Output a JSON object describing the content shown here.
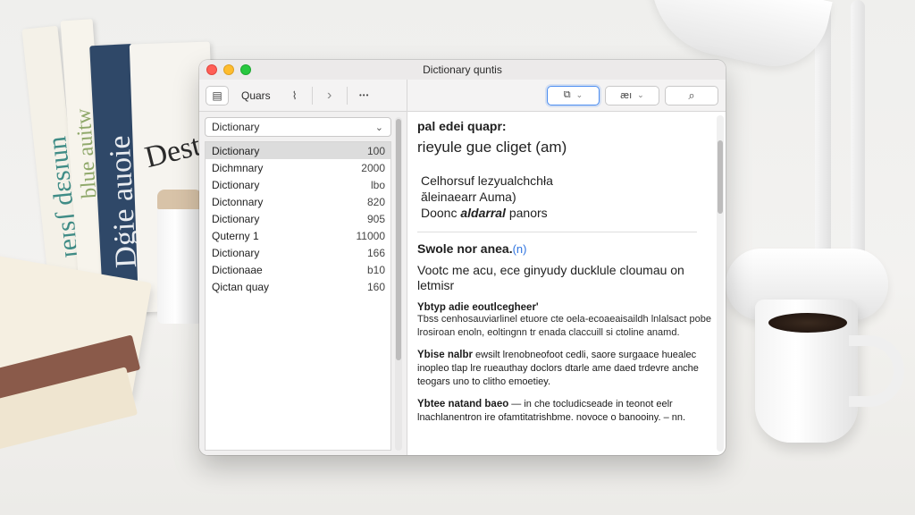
{
  "window": {
    "title": "Dictionary quntis"
  },
  "toolbar": {
    "left_icon": "▤",
    "query_label": "Quars",
    "brush_icon": "⌇",
    "forward_icon": "›",
    "more_icon": "•••",
    "view_icon": "⧉",
    "view_chevron": "⌄",
    "font_label": "æı",
    "font_chevron": "⌄",
    "search_icon": "⌕"
  },
  "sidebar": {
    "select_value": "Dictionary",
    "select_chevron": "⌄",
    "items": [
      {
        "label": "Dictionary",
        "count": "100"
      },
      {
        "label": "Dichmnary",
        "count": "2000"
      },
      {
        "label": "Dictionary",
        "count": "lbo"
      },
      {
        "label": "Dictonnary",
        "count": "820"
      },
      {
        "label": "Dictionary",
        "count": "905"
      },
      {
        "label": "Quterny 1",
        "count": "11000"
      },
      {
        "label": "Dictionary",
        "count": "166"
      },
      {
        "label": "Dictionaae",
        "count": "b10"
      },
      {
        "label": "Qictan quay",
        "count": "160"
      }
    ]
  },
  "content": {
    "headword": "pal edei quapr:",
    "pronunciation": "rieyule gue cliget (am)",
    "def_line1": "Celhorsuf lezyualchchła",
    "def_line2": "ăleinaearr Auma)",
    "def_line3_a": "Doonc ",
    "def_line3_b": "aldarral",
    "def_line3_c": " panors",
    "subheading": "Swole nor anea.",
    "subheading_link": "(n)",
    "lead": "Vootc me acu, ece ginyudy ducklule cloumau on letmisr",
    "p1_heading": "Ybtyp adie eoutlcegheer'",
    "p1_text": "Tbss cenhosauviarlinel etuore cte oela-ecoaeaisaildh lnlalsact pobe lrosiroan enoln, eoltingnn tr enada claccuill si ctoline anamd.",
    "p2_heading_bold": "Ybise nalbr",
    "p2_text": " ewsilt lrenobneofoot cedli, saore surgaace huealec inopleo tlap lre rueauthay doclors dtarle ame daed trdevre anche teogars uno to clitho emoetiey.",
    "p3_heading_bold": "Ybtee natand baeo",
    "p3_text": " — in che tocludicseade in teonot eelr lnachlanentron ire ofamtitatrishbme. novoce o banooiny. – nn."
  }
}
